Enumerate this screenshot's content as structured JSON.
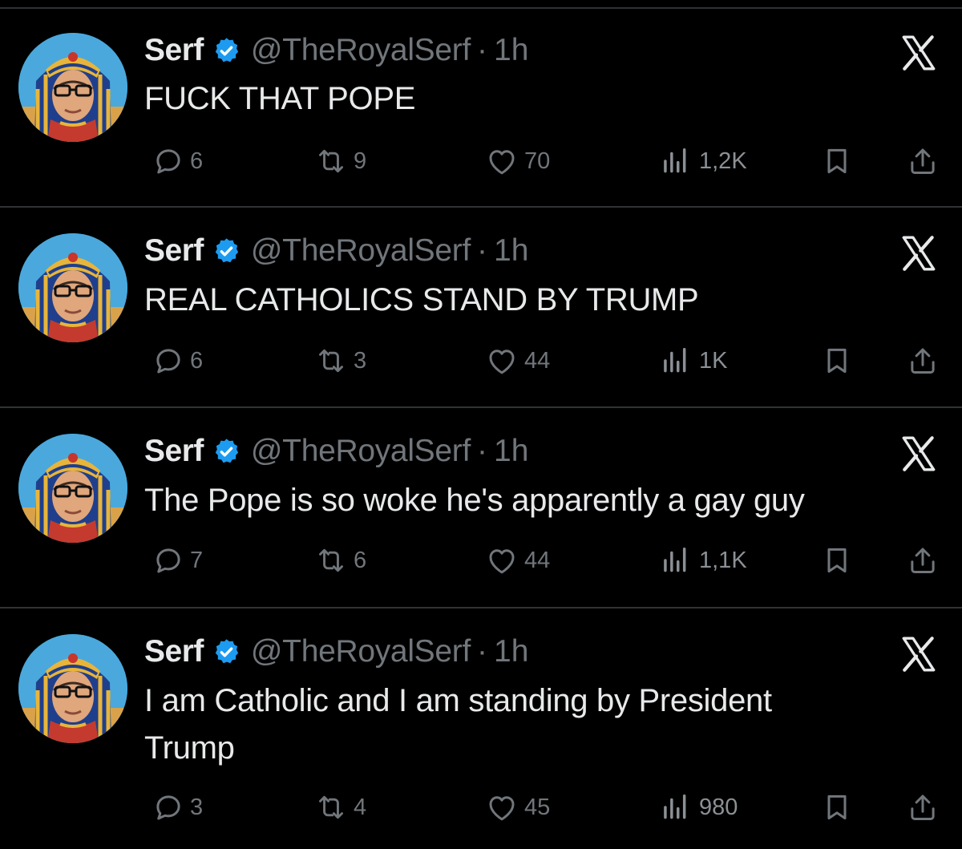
{
  "tweets": [
    {
      "display_name": "Serf",
      "handle": "@TheRoyalSerf",
      "separator": "·",
      "time": "1h",
      "text": "FUCK THAT POPE",
      "replies": "6",
      "retweets": "9",
      "likes": "70",
      "views": "1,2K"
    },
    {
      "display_name": "Serf",
      "handle": "@TheRoyalSerf",
      "separator": "·",
      "time": "1h",
      "text": "REAL CATHOLICS STAND BY TRUMP",
      "replies": "6",
      "retweets": "3",
      "likes": "44",
      "views": "1K"
    },
    {
      "display_name": "Serf",
      "handle": "@TheRoyalSerf",
      "separator": "·",
      "time": "1h",
      "text": "The Pope is so woke he's apparently a gay guy",
      "replies": "7",
      "retweets": "6",
      "likes": "44",
      "views": "1,1K"
    },
    {
      "display_name": "Serf",
      "handle": "@TheRoyalSerf",
      "separator": "·",
      "time": "1h",
      "text": "I am Catholic and I am standing by President Trump",
      "replies": "3",
      "retweets": "4",
      "likes": "45",
      "views": "980"
    }
  ],
  "icons": {
    "verified": "verified-badge-icon",
    "x_logo": "x-logo-icon",
    "reply": "reply-icon",
    "retweet": "retweet-icon",
    "like": "heart-icon",
    "views": "views-chart-icon",
    "bookmark": "bookmark-icon",
    "share": "share-icon"
  },
  "colors": {
    "background": "#000000",
    "text_primary": "#e7e9ea",
    "text_secondary": "#71767b",
    "verified_blue": "#1d9bf0",
    "divider": "#2f3336"
  }
}
